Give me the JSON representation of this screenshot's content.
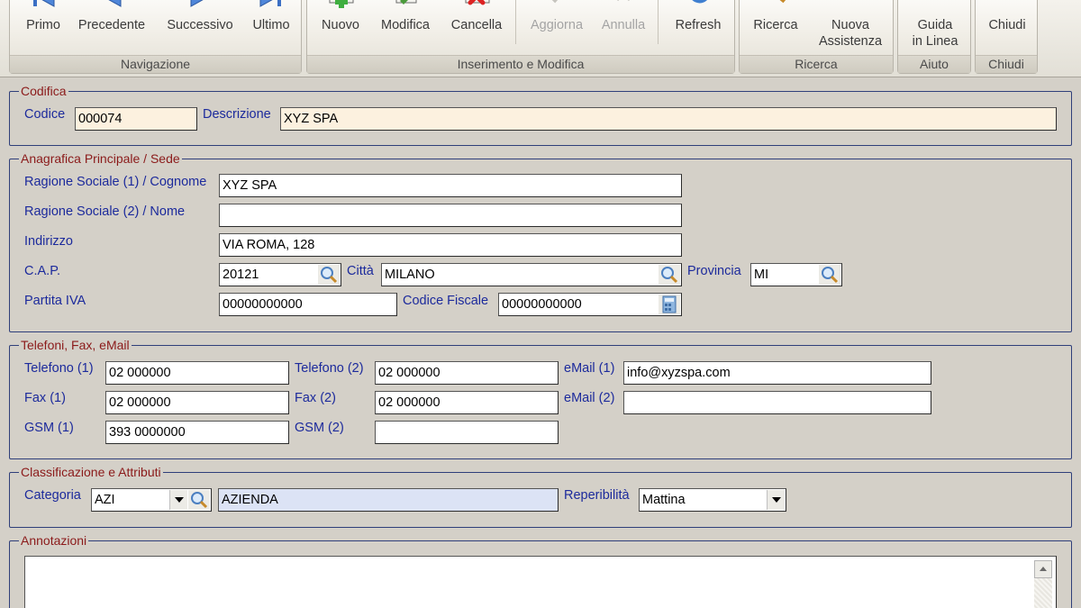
{
  "toolbar": {
    "navigazione": {
      "caption": "Navigazione",
      "primo": "Primo",
      "precedente": "Precedente",
      "successivo": "Successivo",
      "ultimo": "Ultimo"
    },
    "inserimento": {
      "caption": "Inserimento e Modifica",
      "nuovo": "Nuovo",
      "modifica": "Modifica",
      "cancella": "Cancella",
      "aggiorna": "Aggiorna",
      "annulla": "Annulla",
      "refresh": "Refresh"
    },
    "ricerca": {
      "caption": "Ricerca",
      "ricerca": "Ricerca",
      "nuova_l1": "Nuova",
      "nuova_l2": "Assistenza"
    },
    "aiuto": {
      "caption": "Aiuto",
      "guida_l1": "Guida",
      "guida_l2": "in Linea"
    },
    "chiudi": {
      "caption": "Chiudi",
      "chiudi": "Chiudi"
    }
  },
  "codifica": {
    "title": "Codifica",
    "codice_label": "Codice",
    "codice_value": "000074",
    "descrizione_label": "Descrizione",
    "descrizione_value": "XYZ SPA"
  },
  "anagrafica": {
    "title": "Anagrafica Principale / Sede",
    "rs1_label": "Ragione Sociale (1) / Cognome",
    "rs1_value": "XYZ SPA",
    "rs2_label": "Ragione Sociale (2) / Nome",
    "rs2_value": "",
    "indirizzo_label": "Indirizzo",
    "indirizzo_value": "VIA ROMA, 128",
    "cap_label": "C.A.P.",
    "cap_value": "20121",
    "citta_label": "Città",
    "citta_value": "MILANO",
    "provincia_label": "Provincia",
    "provincia_value": "MI",
    "piva_label": "Partita IVA",
    "piva_value": "00000000000",
    "cf_label": "Codice Fiscale",
    "cf_value": "00000000000"
  },
  "contatti": {
    "title": "Telefoni, Fax, eMail",
    "tel1_label": "Telefono (1)",
    "tel1_value": "02 000000",
    "tel2_label": "Telefono (2)",
    "tel2_value": "02 000000",
    "email1_label": "eMail (1)",
    "email1_value": "info@xyzspa.com",
    "fax1_label": "Fax (1)",
    "fax1_value": "02 000000",
    "fax2_label": "Fax (2)",
    "fax2_value": "02 000000",
    "email2_label": "eMail (2)",
    "email2_value": "",
    "gsm1_label": "GSM (1)",
    "gsm1_value": "393 0000000",
    "gsm2_label": "GSM (2)",
    "gsm2_value": ""
  },
  "classificazione": {
    "title": "Classificazione e Attributi",
    "categoria_label": "Categoria",
    "categoria_code": "AZI",
    "categoria_desc": "AZIENDA",
    "reperibilita_label": "Reperibilità",
    "reperibilita_value": "Mattina"
  },
  "annotazioni": {
    "title": "Annotazioni",
    "value": ""
  },
  "colors": {
    "label_blue": "#1c2a9c",
    "section_title_red": "#8b1a1a",
    "field_cream": "#fcf1df",
    "field_blue": "#dce3f5",
    "window_bg": "#d4d0c8"
  }
}
